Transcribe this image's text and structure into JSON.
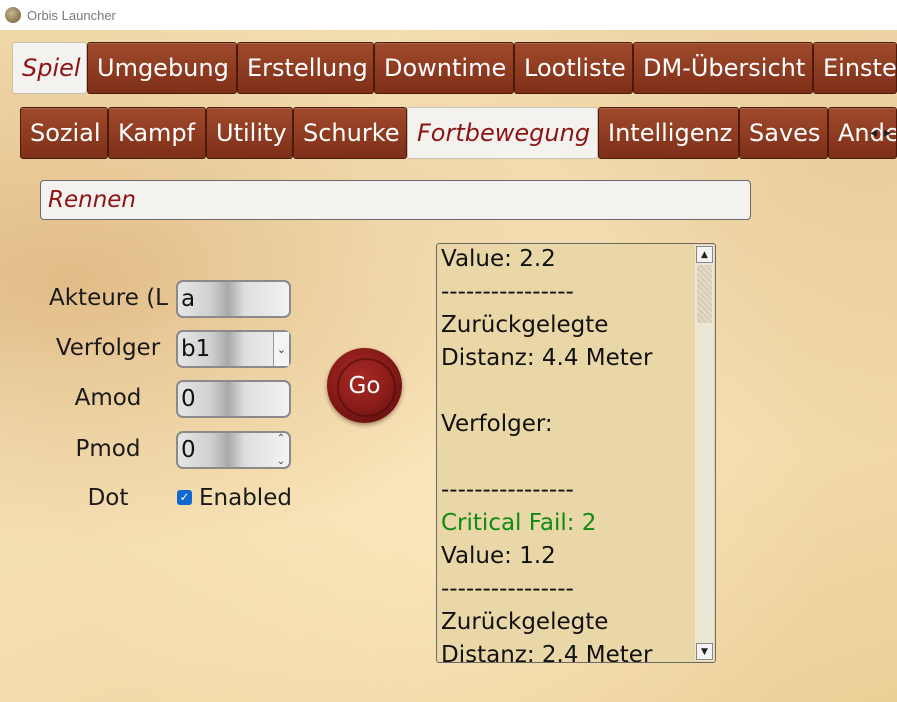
{
  "window": {
    "title": "Orbis Launcher",
    "icon": "app-icon"
  },
  "main_tabs": [
    {
      "label": "Spiel",
      "active": true
    },
    {
      "label": "Umgebung",
      "active": false
    },
    {
      "label": "Erstellung",
      "active": false
    },
    {
      "label": "Downtime",
      "active": false
    },
    {
      "label": "Lootliste",
      "active": false
    },
    {
      "label": "DM-Übersicht",
      "active": false
    },
    {
      "label": "Einstel",
      "active": false
    }
  ],
  "sub_tabs": [
    {
      "label": "Sozial",
      "active": false
    },
    {
      "label": "Kampf",
      "active": false
    },
    {
      "label": "Utility",
      "active": false
    },
    {
      "label": "Schurke",
      "active": false
    },
    {
      "label": "Fortbewegung",
      "active": true
    },
    {
      "label": "Intelligenz",
      "active": false
    },
    {
      "label": "Saves",
      "active": false
    },
    {
      "label": "Ande",
      "active": false
    }
  ],
  "sub_tabs_scroll": {
    "left": "◂",
    "right": "▸"
  },
  "action_name": "Rennen",
  "form": {
    "akteure_label": "Akteure (L",
    "akteure_value": "a",
    "verfolger_label": "Verfolger",
    "verfolger_value": "b1",
    "amod_label": "Amod",
    "amod_value": "0",
    "pmod_label": "Pmod",
    "pmod_value": "0",
    "dot_label": "Dot",
    "dot_checkbox_label": "Enabled",
    "dot_checked": true
  },
  "go_button": {
    "label": "Go"
  },
  "output": {
    "lines": [
      {
        "text": "Value: 2.2",
        "crit": false
      },
      {
        "text": "----------------",
        "crit": false
      },
      {
        "text": "Zurückgelegte",
        "crit": false
      },
      {
        "text": "Distanz: 4.4 Meter",
        "crit": false
      },
      {
        "text": "",
        "crit": false
      },
      {
        "text": "Verfolger:",
        "crit": false
      },
      {
        "text": "",
        "crit": false
      },
      {
        "text": "----------------",
        "crit": false
      },
      {
        "text": "Critical Fail: 2",
        "crit": true
      },
      {
        "text": "Value: 1.2",
        "crit": false
      },
      {
        "text": "----------------",
        "crit": false
      },
      {
        "text": "Zurückgelegte",
        "crit": false
      },
      {
        "text": "Distanz: 2.4 Meter",
        "crit": false
      }
    ]
  },
  "colors": {
    "tab_bg": "#8c3a20",
    "active_tab_text": "#8b1414",
    "critical_text": "#0f8a14",
    "seal": "#8e1d1a",
    "output_bg": "#ead7a7"
  }
}
